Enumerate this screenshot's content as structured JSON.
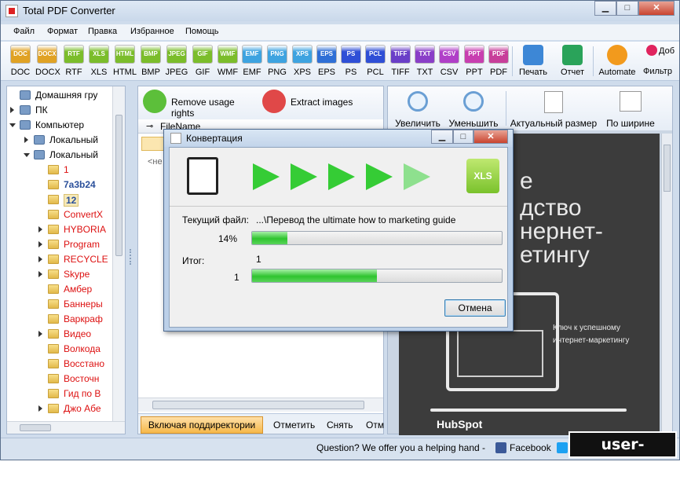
{
  "window": {
    "title": "Total PDF Converter"
  },
  "menu": [
    "Файл",
    "Формат",
    "Правка",
    "Избранное",
    "Помощь"
  ],
  "formats": [
    {
      "icon": "DOC",
      "label": "DOC",
      "color": "#e0a224"
    },
    {
      "icon": "DOCX",
      "label": "DOCX",
      "color": "#e0a224"
    },
    {
      "icon": "RTF",
      "label": "RTF",
      "color": "#7bbd2b"
    },
    {
      "icon": "XLS",
      "label": "XLS",
      "color": "#7bbd2b"
    },
    {
      "icon": "HTML",
      "label": "HTML",
      "color": "#7bbd2b"
    },
    {
      "icon": "BMP",
      "label": "BMP",
      "color": "#7bbd2b"
    },
    {
      "icon": "JPEG",
      "label": "JPEG",
      "color": "#7bbd2b"
    },
    {
      "icon": "GIF",
      "label": "GIF",
      "color": "#7bbd2b"
    },
    {
      "icon": "WMF",
      "label": "WMF",
      "color": "#7bbd2b"
    },
    {
      "icon": "EMF",
      "label": "EMF",
      "color": "#3ea3e0"
    },
    {
      "icon": "PNG",
      "label": "PNG",
      "color": "#3ea3e0"
    },
    {
      "icon": "XPS",
      "label": "XPS",
      "color": "#3ea3e0"
    },
    {
      "icon": "EPS",
      "label": "EPS",
      "color": "#2f6fd6"
    },
    {
      "icon": "PS",
      "label": "PS",
      "color": "#2f4fd6"
    },
    {
      "icon": "PCL",
      "label": "PCL",
      "color": "#2f4fd6"
    },
    {
      "icon": "TIFF",
      "label": "TIFF",
      "color": "#6a3fc8"
    },
    {
      "icon": "TXT",
      "label": "TXT",
      "color": "#8a3fc8"
    },
    {
      "icon": "CSV",
      "label": "CSV",
      "color": "#b03fc8"
    },
    {
      "icon": "PPT",
      "label": "PPT",
      "color": "#c83fb0"
    },
    {
      "icon": "PDF",
      "label": "PDF",
      "color": "#c83f9a"
    }
  ],
  "actions": {
    "print": "Печать",
    "report": "Отчет",
    "automate": "Automate",
    "filter": "Фильтр",
    "donate": "Доб"
  },
  "tree": [
    {
      "label": "Домашняя гру",
      "indent": 1,
      "color": "#000",
      "arrow": "none"
    },
    {
      "label": "ПК",
      "indent": 1,
      "color": "#000",
      "arrow": "right"
    },
    {
      "label": "Компьютер",
      "indent": 1,
      "color": "#000",
      "arrow": "down"
    },
    {
      "label": "Локальный",
      "indent": 2,
      "color": "#000",
      "arrow": "right"
    },
    {
      "label": "Локальный",
      "indent": 2,
      "color": "#000",
      "arrow": "down"
    },
    {
      "label": "1",
      "indent": 3,
      "color": "#d11",
      "arrow": "none"
    },
    {
      "label": "7a3b24",
      "indent": 3,
      "color": "#2a4f9a",
      "arrow": "none"
    },
    {
      "label": "12",
      "indent": 3,
      "color": "#2a4f9a",
      "arrow": "none"
    },
    {
      "label": "ConvertX",
      "indent": 3,
      "color": "#d11",
      "arrow": "none"
    },
    {
      "label": "HYBORIA",
      "indent": 3,
      "color": "#d11",
      "arrow": "right"
    },
    {
      "label": "Program",
      "indent": 3,
      "color": "#d11",
      "arrow": "right"
    },
    {
      "label": "RECYCLE",
      "indent": 3,
      "color": "#d11",
      "arrow": "right"
    },
    {
      "label": "Skype",
      "indent": 3,
      "color": "#d11",
      "arrow": "right"
    },
    {
      "label": "Амбер",
      "indent": 3,
      "color": "#d11",
      "arrow": "none"
    },
    {
      "label": "Баннеры",
      "indent": 3,
      "color": "#d11",
      "arrow": "none"
    },
    {
      "label": "Варкраф",
      "indent": 3,
      "color": "#d11",
      "arrow": "none"
    },
    {
      "label": "Видео",
      "indent": 3,
      "color": "#d11",
      "arrow": "right"
    },
    {
      "label": "Волкода",
      "indent": 3,
      "color": "#d11",
      "arrow": "none"
    },
    {
      "label": "Восстано",
      "indent": 3,
      "color": "#d11",
      "arrow": "none"
    },
    {
      "label": "Восточн",
      "indent": 3,
      "color": "#d11",
      "arrow": "none"
    },
    {
      "label": "Гид по В",
      "indent": 3,
      "color": "#d11",
      "arrow": "none"
    },
    {
      "label": "Джо Абе",
      "indent": 3,
      "color": "#d11",
      "arrow": "right"
    }
  ],
  "mid": {
    "remove_usage": "Remove usage rights",
    "extract_images": "Extract images",
    "col_filename": "FileName",
    "row_placeholder": "<не",
    "include_subdirs": "Включая поддиректории",
    "mark": "Отметить",
    "unmark": "Снять",
    "other": "Отм"
  },
  "preview_toolbar": {
    "zoom_in": "Увеличить",
    "zoom_out": "Уменьшить",
    "actual_size": "Актуальный размер",
    "fit_width": "По ширине"
  },
  "preview_page": {
    "title_lines": [
      "дство",
      "нернет-",
      "етингу"
    ],
    "title_partial": "е",
    "subtitle_lines": [
      "Ключ к успешному",
      "интернет-маркетингу"
    ],
    "brand": "HubSpot"
  },
  "status": {
    "question": "Question? We offer you a helping hand -",
    "facebook": "Facebook"
  },
  "dialog": {
    "title": "Конвертация",
    "target_format": "XLS",
    "current_file_label": "Текущий файл:",
    "current_file_value": "...\\Перевод  the  ultimate  how  to  marketing  guide",
    "file_percent": "14%",
    "file_progress": 0.14,
    "total_label": "Итог:",
    "total_count": "1",
    "total_value": "1",
    "total_progress": 0.5,
    "cancel": "Отмена"
  },
  "watermark": "user-life.com"
}
